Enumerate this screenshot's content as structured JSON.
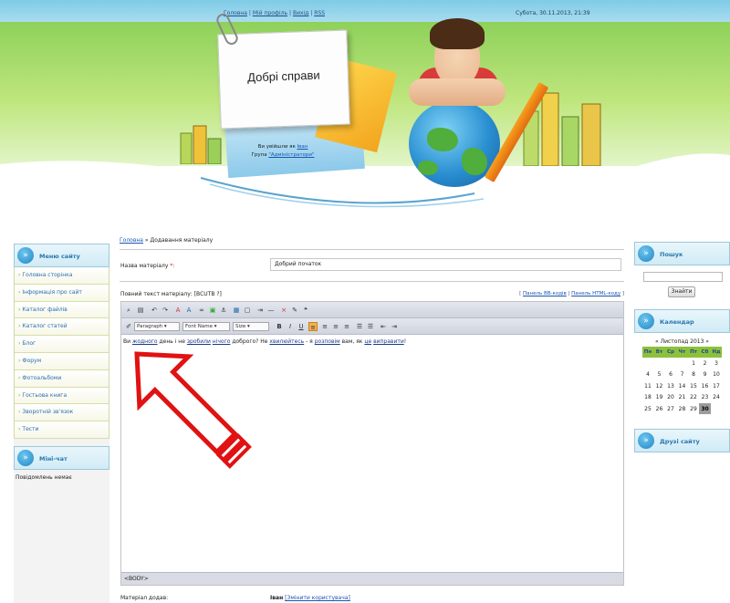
{
  "header": {
    "nav": [
      "Головна",
      "Мій профіль",
      "Вихід",
      "RSS"
    ],
    "nav_separator": "|",
    "datetime": "Субота, 30.11.2013, 21:39",
    "site_title": "Добрі справи",
    "logged_in_text": "Ви увійшли як",
    "user_name": "Іван",
    "group_text": "Група",
    "group_name": "\"Адміністратори\""
  },
  "left": {
    "menu_title": "Меню сайту",
    "menu_items": [
      "Головна сторінка",
      "Інформація про сайт",
      "Каталог файлів",
      "Каталог статей",
      "Блог",
      "Форум",
      "Фотоальбоми",
      "Гостьова книга",
      "Зворотній зв'язок",
      "Тести"
    ],
    "chat_title": "Міні-чат",
    "chat_message": "Повідомлень немає"
  },
  "right": {
    "search_title": "Пошук",
    "search_button": "Знайти",
    "calendar_title": "Календар",
    "calendar_month": "« Листопад 2013 »",
    "weekdays": [
      "Пн",
      "Вт",
      "Ср",
      "Чт",
      "Пт",
      "Сб",
      "Нд"
    ],
    "weeks": [
      [
        "",
        "",
        "",
        "",
        "1",
        "2",
        "3"
      ],
      [
        "4",
        "5",
        "6",
        "7",
        "8",
        "9",
        "10"
      ],
      [
        "11",
        "12",
        "13",
        "14",
        "15",
        "16",
        "17"
      ],
      [
        "18",
        "19",
        "20",
        "21",
        "22",
        "23",
        "24"
      ],
      [
        "25",
        "26",
        "27",
        "28",
        "29",
        "30",
        ""
      ]
    ],
    "today": "30",
    "friends_title": "Друзі сайту"
  },
  "main": {
    "breadcrumb_home": "Головна",
    "breadcrumb_sep": "»",
    "breadcrumb_current": "Додавання матеріалу",
    "title_label": "Назва матеріалу",
    "required_mark": "*:",
    "title_value": "Добрий початок",
    "fulltext_label": "Повний текст матеріалу: [BCUTB ?]",
    "panel_bb": "Панель BB-кодів",
    "panel_html": "Панель HTML-коду",
    "toolbar_paragraph": "Paragraph",
    "toolbar_fontname": "Font Name",
    "toolbar_size": "Size",
    "content_prefix": "Ви",
    "content_u1": "жодного",
    "content_mid1": "день і не",
    "content_u2": "зробили",
    "content_u3": "нічого",
    "content_mid2": "доброго? Не",
    "content_u4": "хвилюйтесь",
    "content_mid3": "- я",
    "content_u5": "розповім",
    "content_mid4": "вам, як",
    "content_u6": "це",
    "content_u7": "виправити",
    "content_end": "!",
    "status_tag": "<BODY>",
    "material_label": "Матеріал додав:",
    "material_user": "Іван",
    "material_link": "[Змінити користувача]"
  },
  "colors": {
    "green_band": "#8ed15a",
    "sky": "#7ecbe6",
    "arrow_red": "#e01212",
    "link_blue": "#1a55b3"
  },
  "annotation": {
    "arrow_icon": "red-outlined-arrow-pointing-up-left"
  }
}
